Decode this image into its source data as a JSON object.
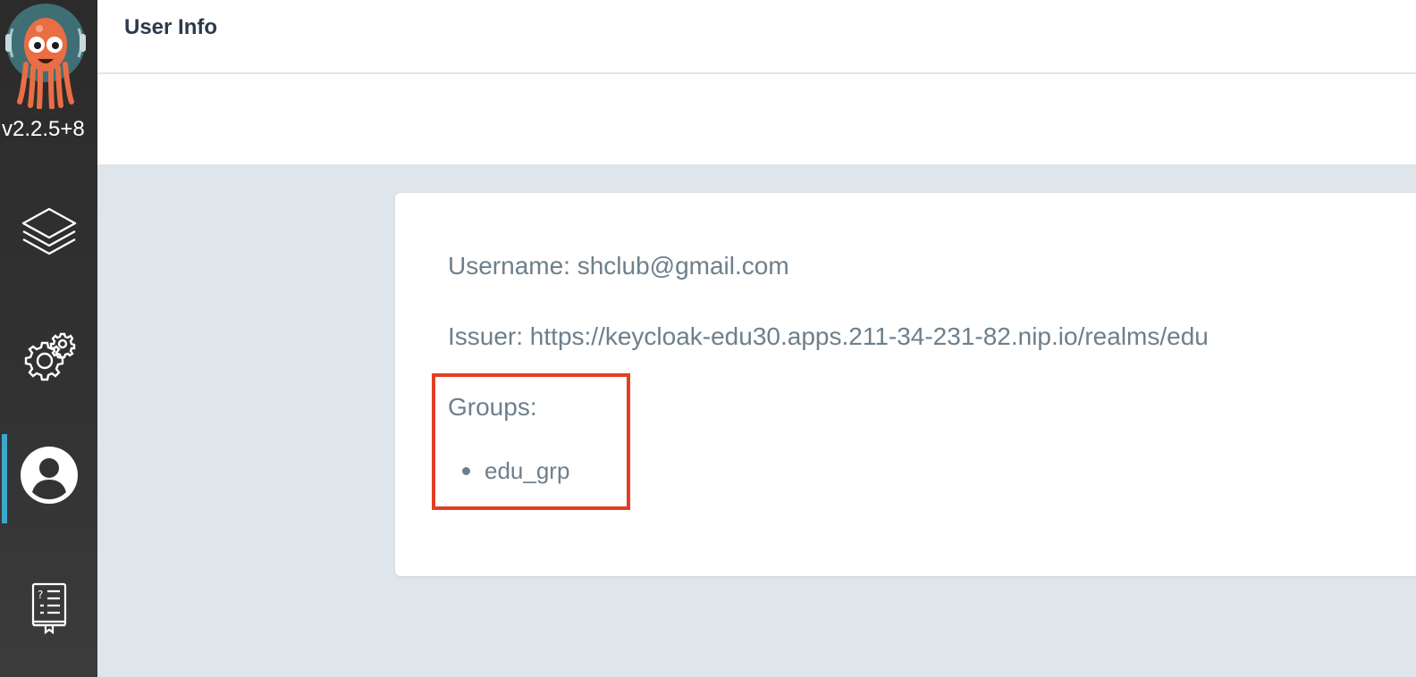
{
  "app": {
    "version": "v2.2.5+8",
    "logo_icon": "argo-octopus-logo-icon"
  },
  "sidebar": {
    "items": [
      {
        "name": "applications",
        "icon": "layers-icon",
        "active": false
      },
      {
        "name": "settings",
        "icon": "gears-icon",
        "active": false
      },
      {
        "name": "user-info",
        "icon": "user-avatar-icon",
        "active": true
      },
      {
        "name": "documentation",
        "icon": "help-book-icon",
        "active": false
      }
    ],
    "active_color": "#3da8c9"
  },
  "header": {
    "title": "User Info"
  },
  "user_info": {
    "username_line": "Username: shclub@gmail.com",
    "issuer_line": "Issuer: https://keycloak-edu30.apps.211-34-231-82.nip.io/realms/edu",
    "groups_label": "Groups:",
    "groups": [
      "edu_grp"
    ],
    "highlight_color": "#e23f24"
  }
}
